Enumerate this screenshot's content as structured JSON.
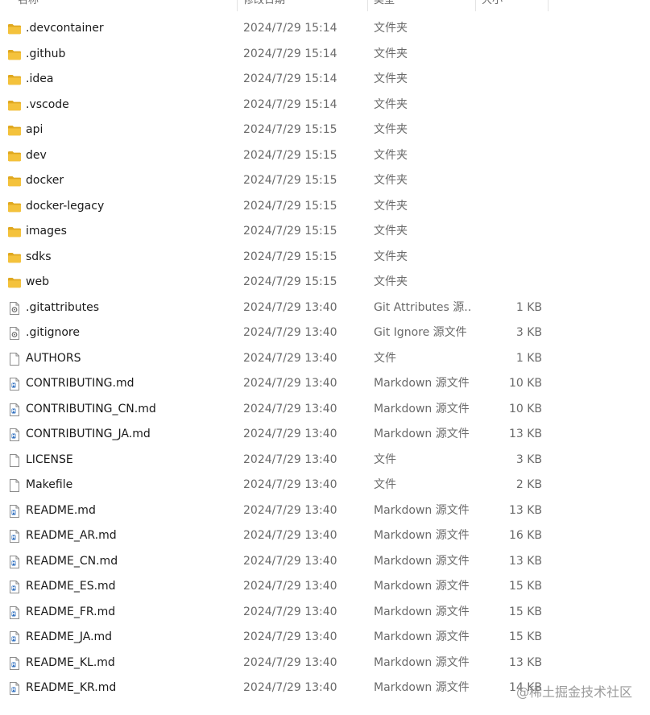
{
  "header": {
    "columns": [
      "名称",
      "修改日期",
      "类型",
      "大小"
    ]
  },
  "colors": {
    "folder": "#f4c23c",
    "folder_tab": "#e0a81f",
    "text": "#1a1a1a",
    "muted": "#6a6a6a"
  },
  "files": [
    {
      "name": ".devcontainer",
      "date": "2024/7/29 15:14",
      "type": "文件夹",
      "size": "",
      "icon": "folder-icon"
    },
    {
      "name": ".github",
      "date": "2024/7/29 15:14",
      "type": "文件夹",
      "size": "",
      "icon": "folder-icon"
    },
    {
      "name": ".idea",
      "date": "2024/7/29 15:14",
      "type": "文件夹",
      "size": "",
      "icon": "folder-icon"
    },
    {
      "name": ".vscode",
      "date": "2024/7/29 15:14",
      "type": "文件夹",
      "size": "",
      "icon": "folder-icon"
    },
    {
      "name": "api",
      "date": "2024/7/29 15:15",
      "type": "文件夹",
      "size": "",
      "icon": "folder-icon"
    },
    {
      "name": "dev",
      "date": "2024/7/29 15:15",
      "type": "文件夹",
      "size": "",
      "icon": "folder-icon"
    },
    {
      "name": "docker",
      "date": "2024/7/29 15:15",
      "type": "文件夹",
      "size": "",
      "icon": "folder-icon"
    },
    {
      "name": "docker-legacy",
      "date": "2024/7/29 15:15",
      "type": "文件夹",
      "size": "",
      "icon": "folder-icon"
    },
    {
      "name": "images",
      "date": "2024/7/29 15:15",
      "type": "文件夹",
      "size": "",
      "icon": "folder-icon"
    },
    {
      "name": "sdks",
      "date": "2024/7/29 15:15",
      "type": "文件夹",
      "size": "",
      "icon": "folder-icon"
    },
    {
      "name": "web",
      "date": "2024/7/29 15:15",
      "type": "文件夹",
      "size": "",
      "icon": "folder-icon"
    },
    {
      "name": ".gitattributes",
      "date": "2024/7/29 13:40",
      "type": "Git Attributes 源...",
      "size": "1 KB",
      "icon": "config-file-icon"
    },
    {
      "name": ".gitignore",
      "date": "2024/7/29 13:40",
      "type": "Git Ignore 源文件",
      "size": "3 KB",
      "icon": "config-file-icon"
    },
    {
      "name": "AUTHORS",
      "date": "2024/7/29 13:40",
      "type": "文件",
      "size": "1 KB",
      "icon": "blank-file-icon"
    },
    {
      "name": "CONTRIBUTING.md",
      "date": "2024/7/29 13:40",
      "type": "Markdown 源文件",
      "size": "10 KB",
      "icon": "markdown-file-icon"
    },
    {
      "name": "CONTRIBUTING_CN.md",
      "date": "2024/7/29 13:40",
      "type": "Markdown 源文件",
      "size": "10 KB",
      "icon": "markdown-file-icon"
    },
    {
      "name": "CONTRIBUTING_JA.md",
      "date": "2024/7/29 13:40",
      "type": "Markdown 源文件",
      "size": "13 KB",
      "icon": "markdown-file-icon"
    },
    {
      "name": "LICENSE",
      "date": "2024/7/29 13:40",
      "type": "文件",
      "size": "3 KB",
      "icon": "blank-file-icon"
    },
    {
      "name": "Makefile",
      "date": "2024/7/29 13:40",
      "type": "文件",
      "size": "2 KB",
      "icon": "blank-file-icon"
    },
    {
      "name": "README.md",
      "date": "2024/7/29 13:40",
      "type": "Markdown 源文件",
      "size": "13 KB",
      "icon": "markdown-file-icon"
    },
    {
      "name": "README_AR.md",
      "date": "2024/7/29 13:40",
      "type": "Markdown 源文件",
      "size": "16 KB",
      "icon": "markdown-file-icon"
    },
    {
      "name": "README_CN.md",
      "date": "2024/7/29 13:40",
      "type": "Markdown 源文件",
      "size": "13 KB",
      "icon": "markdown-file-icon"
    },
    {
      "name": "README_ES.md",
      "date": "2024/7/29 13:40",
      "type": "Markdown 源文件",
      "size": "15 KB",
      "icon": "markdown-file-icon"
    },
    {
      "name": "README_FR.md",
      "date": "2024/7/29 13:40",
      "type": "Markdown 源文件",
      "size": "15 KB",
      "icon": "markdown-file-icon"
    },
    {
      "name": "README_JA.md",
      "date": "2024/7/29 13:40",
      "type": "Markdown 源文件",
      "size": "15 KB",
      "icon": "markdown-file-icon"
    },
    {
      "name": "README_KL.md",
      "date": "2024/7/29 13:40",
      "type": "Markdown 源文件",
      "size": "13 KB",
      "icon": "markdown-file-icon"
    },
    {
      "name": "README_KR.md",
      "date": "2024/7/29 13:40",
      "type": "Markdown 源文件",
      "size": "14 KB",
      "icon": "markdown-file-icon"
    }
  ],
  "watermark": "@稀土掘金技术社区"
}
